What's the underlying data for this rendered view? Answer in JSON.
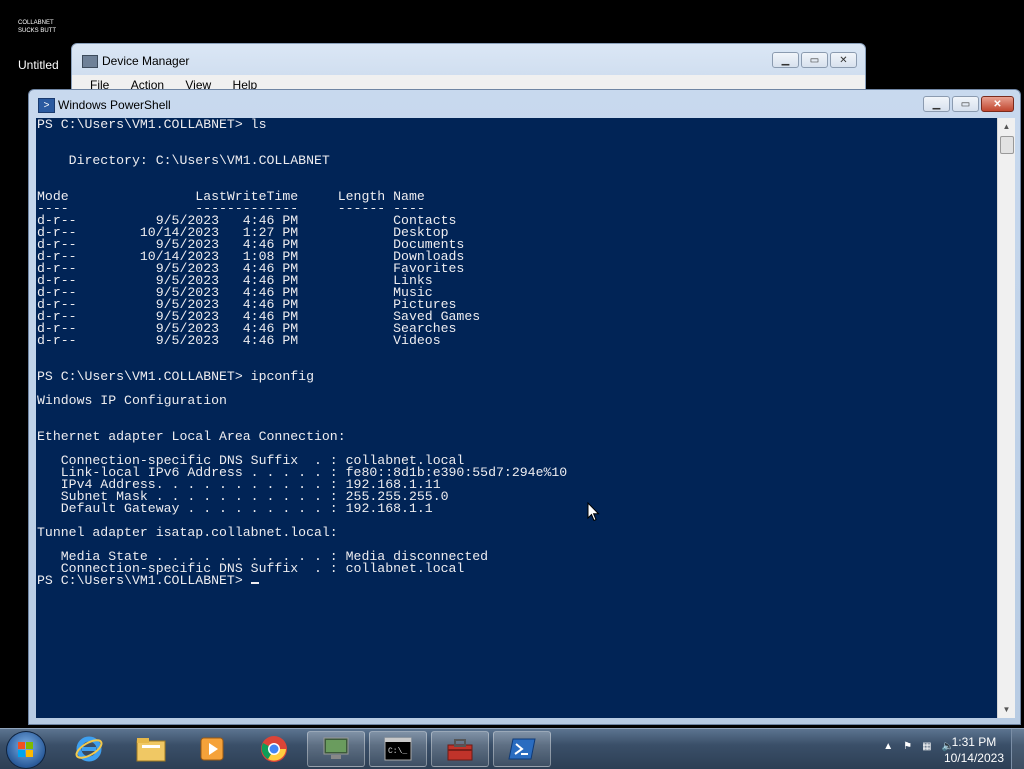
{
  "desktop": {
    "label_line1": "COLLABNET",
    "label_line2": "SUCKS BUTT",
    "untitled_label": "Untitled"
  },
  "device_manager": {
    "title": "Device Manager",
    "menu": [
      "File",
      "Action",
      "View",
      "Help"
    ]
  },
  "powershell": {
    "title": "Windows PowerShell",
    "lines": [
      "PS C:\\Users\\VM1.COLLABNET> ls",
      "",
      "",
      "    Directory: C:\\Users\\VM1.COLLABNET",
      "",
      "",
      "Mode                LastWriteTime     Length Name",
      "----                -------------     ------ ----",
      "d-r--          9/5/2023   4:46 PM            Contacts",
      "d-r--        10/14/2023   1:27 PM            Desktop",
      "d-r--          9/5/2023   4:46 PM            Documents",
      "d-r--        10/14/2023   1:08 PM            Downloads",
      "d-r--          9/5/2023   4:46 PM            Favorites",
      "d-r--          9/5/2023   4:46 PM            Links",
      "d-r--          9/5/2023   4:46 PM            Music",
      "d-r--          9/5/2023   4:46 PM            Pictures",
      "d-r--          9/5/2023   4:46 PM            Saved Games",
      "d-r--          9/5/2023   4:46 PM            Searches",
      "d-r--          9/5/2023   4:46 PM            Videos",
      "",
      "",
      "PS C:\\Users\\VM1.COLLABNET> ipconfig",
      "",
      "Windows IP Configuration",
      "",
      "",
      "Ethernet adapter Local Area Connection:",
      "",
      "   Connection-specific DNS Suffix  . : collabnet.local",
      "   Link-local IPv6 Address . . . . . : fe80::8d1b:e390:55d7:294e%10",
      "   IPv4 Address. . . . . . . . . . . : 192.168.1.11",
      "   Subnet Mask . . . . . . . . . . . : 255.255.255.0",
      "   Default Gateway . . . . . . . . . : 192.168.1.1",
      "",
      "Tunnel adapter isatap.collabnet.local:",
      "",
      "   Media State . . . . . . . . . . . : Media disconnected",
      "   Connection-specific DNS Suffix  . : collabnet.local"
    ],
    "prompt": "PS C:\\Users\\VM1.COLLABNET> ",
    "background_color": "#012456",
    "text_color": "#eeedf0"
  },
  "taskbar": {
    "pinned": [
      "start-button",
      "internet-explorer-icon",
      "file-explorer-icon",
      "media-player-icon",
      "chrome-icon",
      "device-manager-icon",
      "cmd-icon",
      "toolbox-icon",
      "powershell-icon"
    ],
    "active_item": "powershell-icon",
    "clock_time": "1:31 PM",
    "clock_date": "10/14/2023"
  }
}
